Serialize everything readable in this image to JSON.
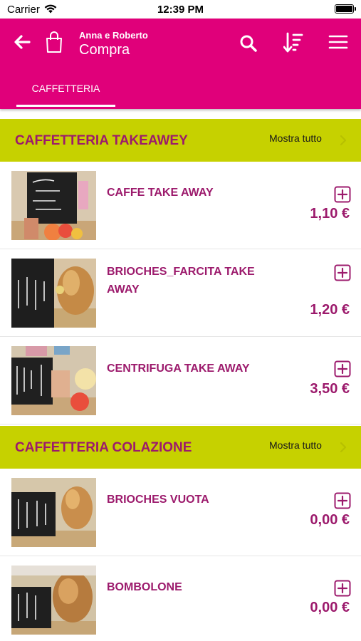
{
  "status": {
    "carrier": "Carrier",
    "time": "12:39 PM"
  },
  "header": {
    "user": "Anna e Roberto",
    "title": "Compra"
  },
  "tabs": [
    {
      "label": "CAFFETTERIA",
      "active": true
    }
  ],
  "colors": {
    "primary": "#e0007a",
    "section": "#c6d100",
    "text_accent": "#9c1a6c"
  },
  "sections": [
    {
      "title": "CAFFETTERIA TAKEAWEY",
      "show_all": "Mostra tutto",
      "products": [
        {
          "name": "CAFFE TAKE AWAY",
          "price": "1,10 €"
        },
        {
          "name": "BRIOCHES_FARCITA TAKE AWAY",
          "price": "1,20 €"
        },
        {
          "name": "CENTRIFUGA TAKE AWAY",
          "price": "3,50 €"
        }
      ]
    },
    {
      "title": "CAFFETTERIA COLAZIONE",
      "show_all": "Mostra tutto",
      "products": [
        {
          "name": "BRIOCHES VUOTA",
          "price": "0,00 €"
        },
        {
          "name": "BOMBOLONE",
          "price": "0,00 €"
        }
      ]
    }
  ]
}
